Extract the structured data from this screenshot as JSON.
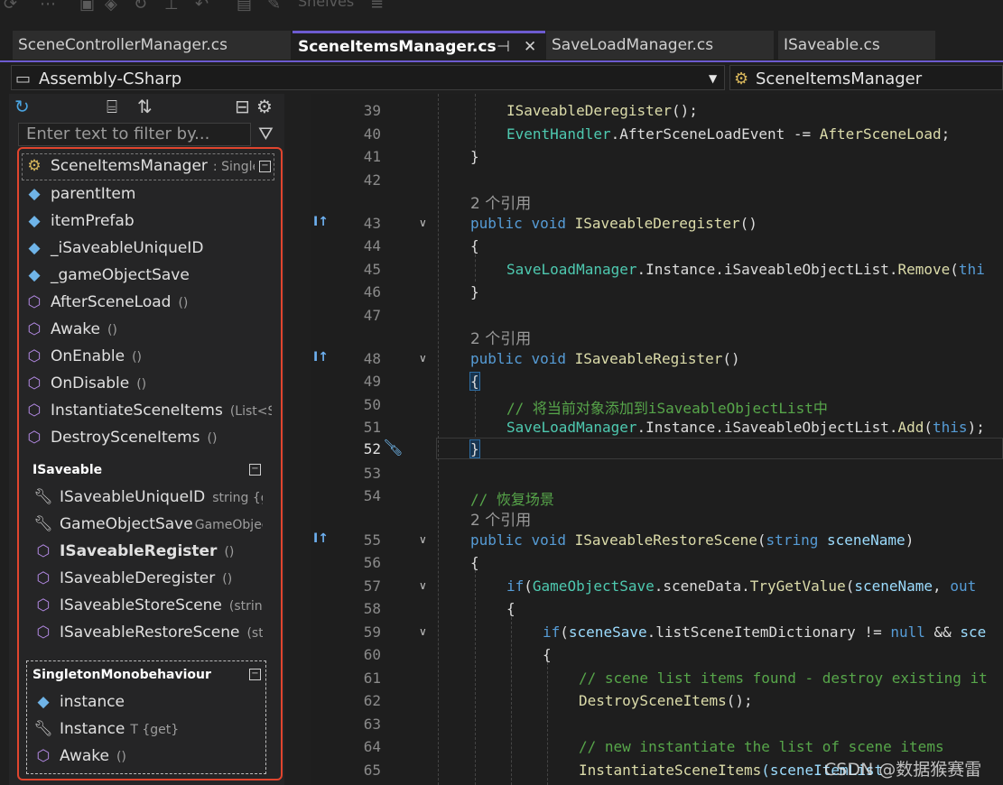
{
  "toolbar": {
    "shelves_label": "Shelves"
  },
  "tabs": [
    {
      "label": "SceneControllerManager.cs"
    },
    {
      "label": "SceneItemsManager.cs",
      "pin": "⊣",
      "close": "✕"
    },
    {
      "label": "SaveLoadManager.cs"
    },
    {
      "label": "ISaveable.cs"
    }
  ],
  "nav": {
    "project": "Assembly-CSharp",
    "class": "SceneItemsManager"
  },
  "panel": {
    "filter_placeholder": "Enter text to filter by...",
    "class_header": {
      "name": "SceneItemsManager",
      "base": ": Singleto"
    },
    "members": [
      {
        "label": "parentItem",
        "sig": "",
        "kind": "field"
      },
      {
        "label": "itemPrefab",
        "sig": "",
        "kind": "field"
      },
      {
        "label": "_iSaveableUniqueID",
        "sig": "",
        "kind": "field"
      },
      {
        "label": "_gameObjectSave",
        "sig": "",
        "kind": "field"
      },
      {
        "label": "AfterSceneLoad",
        "sig": "()",
        "kind": "method"
      },
      {
        "label": "Awake",
        "sig": "()",
        "kind": "method"
      },
      {
        "label": "OnEnable",
        "sig": "()",
        "kind": "method"
      },
      {
        "label": "OnDisable",
        "sig": "()",
        "kind": "method"
      },
      {
        "label": "InstantiateSceneItems",
        "sig": "(List<Scer",
        "kind": "method"
      },
      {
        "label": "DestroySceneItems",
        "sig": "()",
        "kind": "method"
      }
    ],
    "isaveable_group": {
      "title": "ISaveable",
      "items": [
        {
          "label": "ISaveableUniqueID",
          "sig": "string {get",
          "kind": "prop"
        },
        {
          "label": "GameObjectSave",
          "sig": "GameObjectS",
          "kind": "prop"
        },
        {
          "label": "ISaveableRegister",
          "sig": "()",
          "kind": "method"
        },
        {
          "label": "ISaveableDeregister",
          "sig": "()",
          "kind": "method"
        },
        {
          "label": "ISaveableStoreScene",
          "sig": "(string)",
          "kind": "method"
        },
        {
          "label": "ISaveableRestoreScene",
          "sig": "(string",
          "kind": "method"
        }
      ]
    },
    "singleton_group": {
      "title": "SingletonMonobehaviour",
      "items": [
        {
          "label": "instance",
          "sig": "",
          "kind": "field"
        },
        {
          "label": "Instance",
          "sig": "T {get}",
          "kind": "prop"
        },
        {
          "label": "Awake",
          "sig": "()",
          "kind": "method"
        }
      ]
    }
  },
  "editor": {
    "line_numbers": [
      "39",
      "40",
      "41",
      "42",
      "43",
      "44",
      "45",
      "46",
      "47",
      "48",
      "49",
      "50",
      "51",
      "52",
      "53",
      "54",
      "55",
      "56",
      "57",
      "58",
      "59",
      "60",
      "61",
      "62",
      "63",
      "64",
      "65"
    ],
    "hint_2refs": "2 个引用",
    "lines": {
      "l39_method": "ISaveableDeregister",
      "l39_rest": "();",
      "l40_handler": "EventHandler",
      "l40_event": ".AfterSceneLoadEvent -= ",
      "l40_method": "AfterSceneLoad",
      "l40_semi": ";",
      "close_brace": "}",
      "open_brace": "{",
      "kw_public": "public",
      "kw_void": "void",
      "kw_string": "string",
      "kw_if": "if",
      "kw_out": "out",
      "kw_null": "null",
      "kw_this": "this",
      "thi_trunc": "thi",
      "l43_method": "ISaveableDeregister",
      "parens": "()",
      "slm": "SaveLoadManager",
      "instance_list": ".Instance.iSaveableObjectList.",
      "remove": "Remove",
      "add": "Add",
      "paren_open": "(",
      "paren_close_semi": ");",
      "l48_method": "ISaveableRegister",
      "l50_comment": "// 将当前对象添加到iSaveableObjectList中",
      "l54_comment": "// 恢复场景",
      "l55_method": "ISaveableRestoreScene",
      "l55_param": "sceneName",
      "l55_close": ")",
      "l57_obj": "GameObjectSave",
      "l57_mid": ".sceneData.",
      "l57_method": "TryGetValue",
      "l57_arg": "sceneName",
      "comma": ", ",
      "l59_obj": "sceneSave",
      "l59_mid": ".listSceneItemDictionary != ",
      "l59_and": " && ",
      "l59_trunc": "sce",
      "l61_comment": "// scene list items found - destroy existing it",
      "l62_method": "DestroySceneItems",
      "l62_rest": "();",
      "l64_comment": "// new instantiate the list of scene items",
      "l65_method": "InstantiateSceneItems",
      "l65_rest": "(sceneItemList"
    }
  },
  "watermark": "CSDN @数据猴赛雷"
}
